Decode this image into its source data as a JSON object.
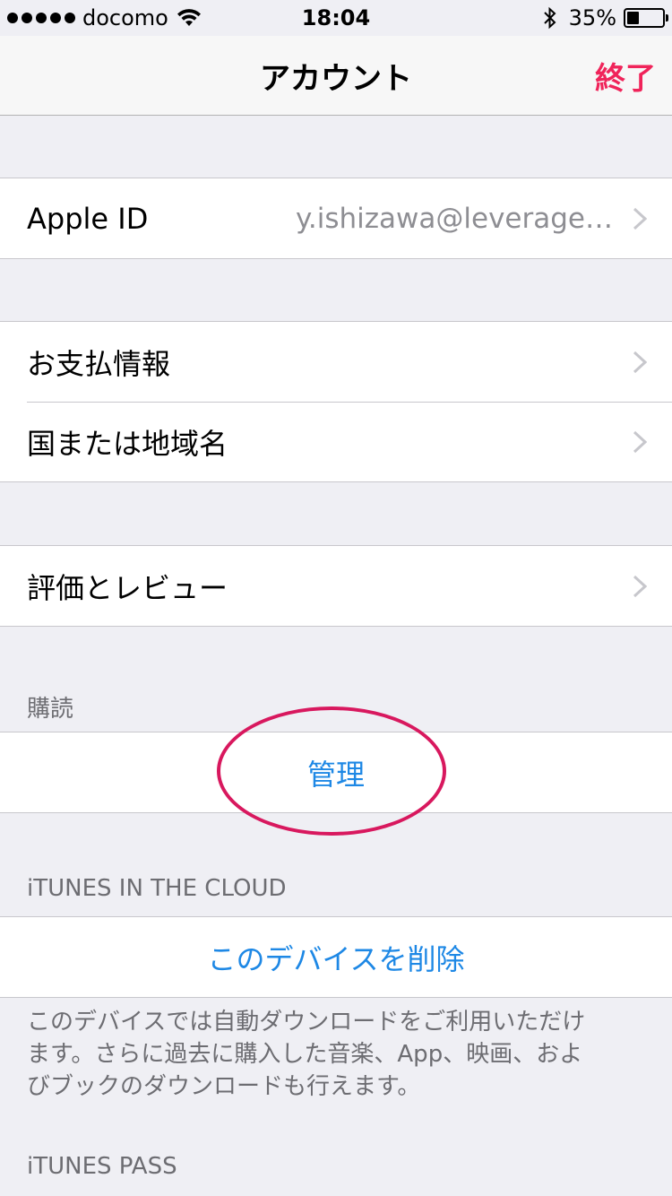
{
  "status_bar": {
    "carrier": "docomo",
    "time": "18:04",
    "battery_percent": "35%",
    "battery_level": 0.35
  },
  "nav": {
    "title": "アカウント",
    "done_label": "終了",
    "done_color": "#f0245a"
  },
  "rows": {
    "apple_id": {
      "label": "Apple ID",
      "value": "y.ishizawa@leverage…"
    },
    "payment": {
      "label": "お支払情報"
    },
    "country": {
      "label": "国または地域名"
    },
    "ratings": {
      "label": "評価とレビュー"
    }
  },
  "subscriptions": {
    "header": "購読",
    "manage_label": "管理"
  },
  "itunes_cloud": {
    "header": "iTUNES IN THE CLOUD",
    "remove_device_label": "このデバイスを削除",
    "footer_line1": "このデバイスでは自動ダウンロードをご利用いただけ",
    "footer_line2": "ます。さらに過去に購入した音楽、App、映画、およ",
    "footer_line3": "びブックのダウンロードも行えます。"
  },
  "itunes_pass": {
    "header": "iTUNES PASS"
  },
  "colors": {
    "link_blue": "#1e88e5",
    "annotation_circle": "#d8185e",
    "background": "#efeff4"
  }
}
